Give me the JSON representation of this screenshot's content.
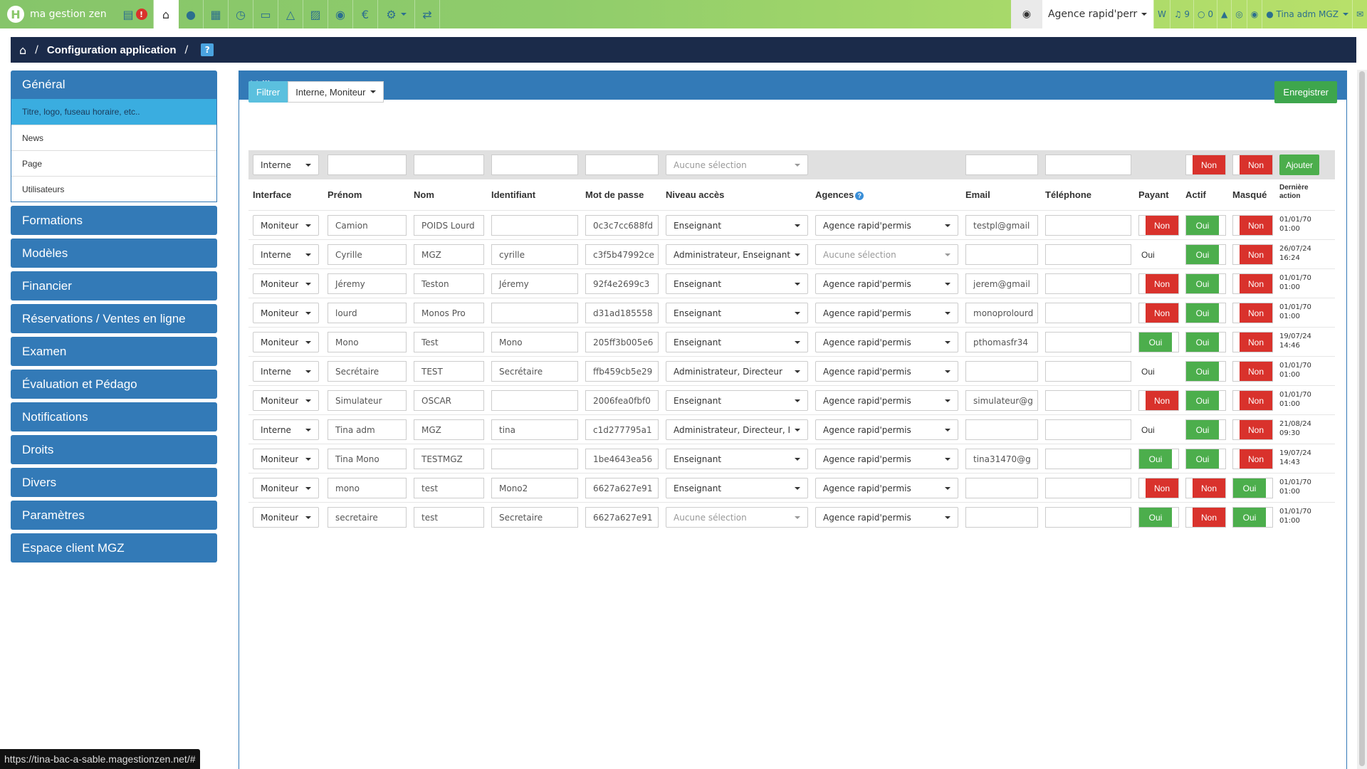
{
  "app": {
    "brand": "ma gestion zen",
    "alert_badge": "!",
    "agency": "Agence rapid'perr",
    "nav_icons": [
      "news-icon",
      "home-icon",
      "user-icon",
      "calendar-icon",
      "clock-icon",
      "card-icon",
      "person-icon",
      "car-icon",
      "map-pin-icon",
      "euro-icon",
      "settings-icon",
      "shuffle-icon"
    ],
    "top_right": {
      "w_label": "W",
      "notif_count": "9",
      "warn_count": "0",
      "user": "Tina adm MGZ"
    }
  },
  "breadcrumb": {
    "title": "Configuration application",
    "sep": "/",
    "help": "?"
  },
  "sidebar": {
    "general": "Général",
    "subitems": [
      "Titre, logo, fuseau horaire, etc..",
      "News",
      "Page",
      "Utilisateurs"
    ],
    "sections": [
      "Formations",
      "Modèles",
      "Financier",
      "Réservations / Ventes en ligne",
      "Examen",
      "Évaluation et Pédago",
      "Notifications",
      "Droits",
      "Divers",
      "Paramètres",
      "Espace client MGZ"
    ]
  },
  "panel": {
    "title": "Utilisateurs",
    "filter_label": "Filtrer",
    "filter_value": "Interne, Moniteur",
    "save_label": "Enregistrer"
  },
  "add_row": {
    "interface": "Interne",
    "niveau_placeholder": "Aucune sélection",
    "payant": "Non",
    "actif": "Non",
    "add_label": "Ajouter"
  },
  "headers": {
    "interface": "Interface",
    "prenom": "Prénom",
    "nom": "Nom",
    "identifiant": "Identifiant",
    "mdp": "Mot de passe",
    "niveau": "Niveau accès",
    "agences": "Agences",
    "email": "Email",
    "telephone": "Téléphone",
    "payant": "Payant",
    "actif": "Actif",
    "masque": "Masqué",
    "derniere_1": "Dernière",
    "derniere_2": "action"
  },
  "rows": [
    {
      "interface": "Moniteur",
      "prenom": "Camion",
      "nom": "POIDS Lourd",
      "identifiant": "",
      "mdp": "0c3c7cc688fd",
      "niveau": "Enseignant",
      "agence": "Agence rapid'permis",
      "email": "testpl@gmail",
      "telephone": "",
      "payant": "Non",
      "actif": "Oui",
      "masque": "Non",
      "date": "01/01/70",
      "time": "01:00"
    },
    {
      "interface": "Interne",
      "prenom": "Cyrille",
      "nom": "MGZ",
      "identifiant": "cyrille",
      "mdp": "c3f5b47992ce",
      "niveau": "Administrateur, Enseignant",
      "agence": "Aucune sélection",
      "email": "",
      "telephone": "",
      "payant": "Oui",
      "actif": "Oui",
      "masque": "Non",
      "date": "26/07/24",
      "time": "16:24"
    },
    {
      "interface": "Moniteur",
      "prenom": "Jéremy",
      "nom": "Teston",
      "identifiant": "Jéremy",
      "mdp": "92f4e2699c3",
      "niveau": "Enseignant",
      "agence": "Agence rapid'permis",
      "email": "jerem@gmail",
      "telephone": "",
      "payant": "Non",
      "actif": "Oui",
      "masque": "Non",
      "date": "01/01/70",
      "time": "01:00"
    },
    {
      "interface": "Moniteur",
      "prenom": "lourd",
      "nom": "Monos Pro",
      "identifiant": "",
      "mdp": "d31ad185558",
      "niveau": "Enseignant",
      "agence": "Agence rapid'permis",
      "email": "monoprolourd",
      "telephone": "",
      "payant": "Non",
      "actif": "Oui",
      "masque": "Non",
      "date": "01/01/70",
      "time": "01:00"
    },
    {
      "interface": "Moniteur",
      "prenom": "Mono",
      "nom": "Test",
      "identifiant": "Mono",
      "mdp": "205ff3b005e6",
      "niveau": "Enseignant",
      "agence": "Agence rapid'permis",
      "email": "pthomasfr34",
      "telephone": "",
      "payant": "Oui",
      "actif": "Oui",
      "masque": "Non",
      "date": "19/07/24",
      "time": "14:46"
    },
    {
      "interface": "Interne",
      "prenom": "Secrétaire",
      "nom": "TEST",
      "identifiant": "Secrétaire",
      "mdp": "ffb459cb5e29",
      "niveau": "Administrateur, Directeur",
      "agence": "Agence rapid'permis",
      "email": "",
      "telephone": "",
      "payant": "Oui",
      "actif": "Oui",
      "masque": "Non",
      "date": "01/01/70",
      "time": "01:00"
    },
    {
      "interface": "Moniteur",
      "prenom": "Simulateur",
      "nom": "OSCAR",
      "identifiant": "",
      "mdp": "2006fea0fbf0",
      "niveau": "Enseignant",
      "agence": "Agence rapid'permis",
      "email": "simulateur@g",
      "telephone": "",
      "payant": "Non",
      "actif": "Oui",
      "masque": "Non",
      "date": "01/01/70",
      "time": "01:00"
    },
    {
      "interface": "Interne",
      "prenom": "Tina adm",
      "nom": "MGZ",
      "identifiant": "tina",
      "mdp": "c1d277795a1",
      "niveau": "Administrateur, Directeur, I",
      "agence": "Agence rapid'permis",
      "email": "",
      "telephone": "",
      "payant": "Oui",
      "actif": "Oui",
      "masque": "Non",
      "date": "21/08/24",
      "time": "09:30"
    },
    {
      "interface": "Moniteur",
      "prenom": "Tina Mono",
      "nom": "TESTMGZ",
      "identifiant": "",
      "mdp": "1be4643ea56",
      "niveau": "Enseignant",
      "agence": "Agence rapid'permis",
      "email": "tina31470@g",
      "telephone": "",
      "payant": "Oui",
      "actif": "Oui",
      "masque": "Non",
      "date": "19/07/24",
      "time": "14:43"
    },
    {
      "interface": "Moniteur",
      "prenom": "mono",
      "nom": "test",
      "identifiant": "Mono2",
      "mdp": "6627a627e91",
      "niveau": "Enseignant",
      "agence": "Agence rapid'permis",
      "email": "",
      "telephone": "",
      "payant": "Non",
      "actif": "Non",
      "masque": "Oui",
      "date": "01/01/70",
      "time": "01:00"
    },
    {
      "interface": "Moniteur",
      "prenom": "secretaire",
      "nom": "test",
      "identifiant": "Secretaire",
      "mdp": "6627a627e91",
      "niveau": "Aucune sélection",
      "agence": "Agence rapid'permis",
      "email": "",
      "telephone": "",
      "payant": "Oui",
      "actif": "Non",
      "masque": "Oui",
      "date": "01/01/70",
      "time": "01:00"
    }
  ],
  "statusbar": "https://tina-bac-a-sable.magestionzen.net/#",
  "colors": {
    "primary": "#337ab7",
    "info": "#5bc0de",
    "success": "#4cae4c",
    "danger": "#d9322c",
    "nav_dark": "#1b2b4a",
    "topbar": "#8ac76a"
  }
}
